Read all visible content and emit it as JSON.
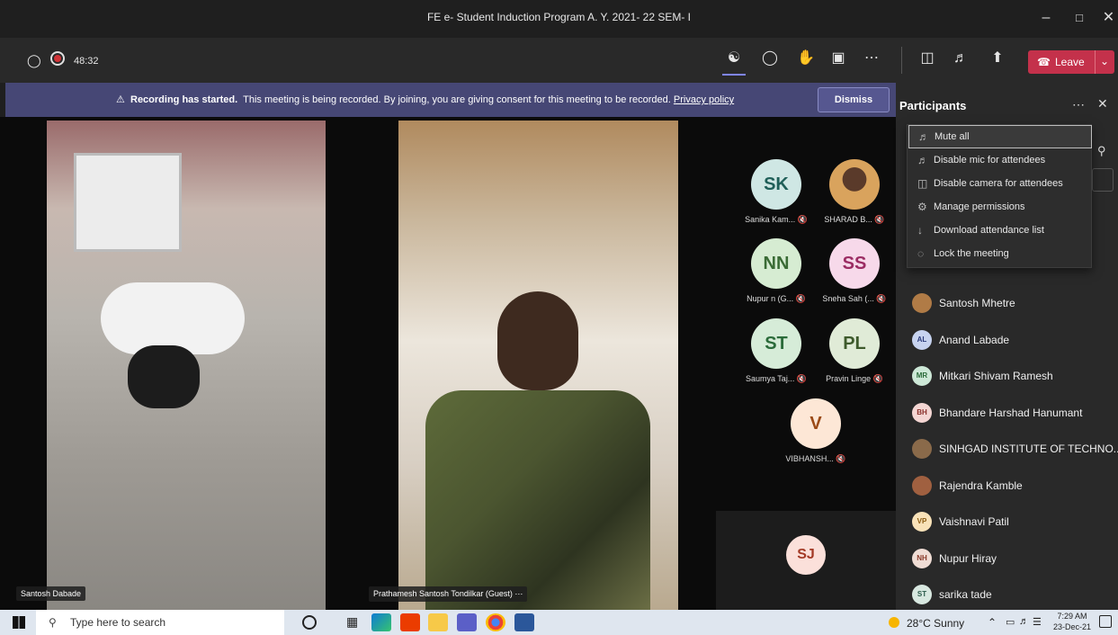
{
  "window": {
    "title": "FE e- Student Induction Program A. Y. 2021- 22 SEM- I"
  },
  "controls": {
    "timer": "48:32",
    "leave_label": "Leave"
  },
  "banner": {
    "bold": "Recording has started.",
    "text": "This meeting is being recorded. By joining, you are giving consent for this meeting to be recorded.",
    "link": "Privacy policy",
    "dismiss": "Dismiss"
  },
  "videos": [
    {
      "name": "Santosh Dabade"
    },
    {
      "name": "Prathamesh Santosh Tondilkar (Guest)"
    }
  ],
  "tiles": [
    {
      "initials": "SK",
      "label": "Sanika Kam...",
      "color": "#cfe7e4",
      "text": "#1f5f58"
    },
    {
      "initials": "",
      "label": "SHARAD B...",
      "color": "#d9a35d",
      "text": "#fff"
    },
    {
      "initials": "NN",
      "label": "Nupur n (G...",
      "color": "#d6ecd2",
      "text": "#3a6b35"
    },
    {
      "initials": "SS",
      "label": "Sneha Sah (...",
      "color": "#f7d9ea",
      "text": "#9b2c63"
    },
    {
      "initials": "ST",
      "label": "Saumya Taj...",
      "color": "#d6ecd8",
      "text": "#2b6b3a"
    },
    {
      "initials": "PL",
      "label": "Pravin Linge",
      "color": "#e0ebd7",
      "text": "#3e5a2c"
    },
    {
      "initials": "V",
      "label": "VIBHANSH...",
      "color": "#fde7d6",
      "text": "#9b4a16"
    },
    {
      "initials": "SJ",
      "label": "",
      "color": "#fbe0da",
      "text": "#a33a26"
    }
  ],
  "panel": {
    "title": "Participants",
    "menu": [
      "Mute all",
      "Disable mic for attendees",
      "Disable camera for attendees",
      "Manage permissions",
      "Download attendance list",
      "Lock the meeting"
    ],
    "people": [
      {
        "initials": "",
        "name": "Santosh Mhetre",
        "color": "#b07b46"
      },
      {
        "initials": "AL",
        "name": "Anand Labade",
        "color": "#c7d3f0"
      },
      {
        "initials": "MR",
        "name": "Mitkari Shivam Ramesh",
        "color": "#cde8d7"
      },
      {
        "initials": "BH",
        "name": "Bhandare Harshad Hanumant",
        "color": "#f4d6d3"
      },
      {
        "initials": "",
        "name": "SINHGAD INSTITUTE OF TECHNO...",
        "color": "#8a6a4a"
      },
      {
        "initials": "",
        "name": "Rajendra Kamble",
        "color": "#a06040"
      },
      {
        "initials": "VP",
        "name": "Vaishnavi Patil",
        "color": "#f9e2b8"
      },
      {
        "initials": "NH",
        "name": "Nupur Hiray",
        "color": "#f0ddd5"
      },
      {
        "initials": "ST",
        "name": "sarika tade",
        "color": "#d8e8e0"
      }
    ]
  },
  "taskbar": {
    "search_placeholder": "Type here to search",
    "weather": "28°C  Sunny",
    "time": "7:29 AM",
    "date": "23-Dec-21"
  }
}
